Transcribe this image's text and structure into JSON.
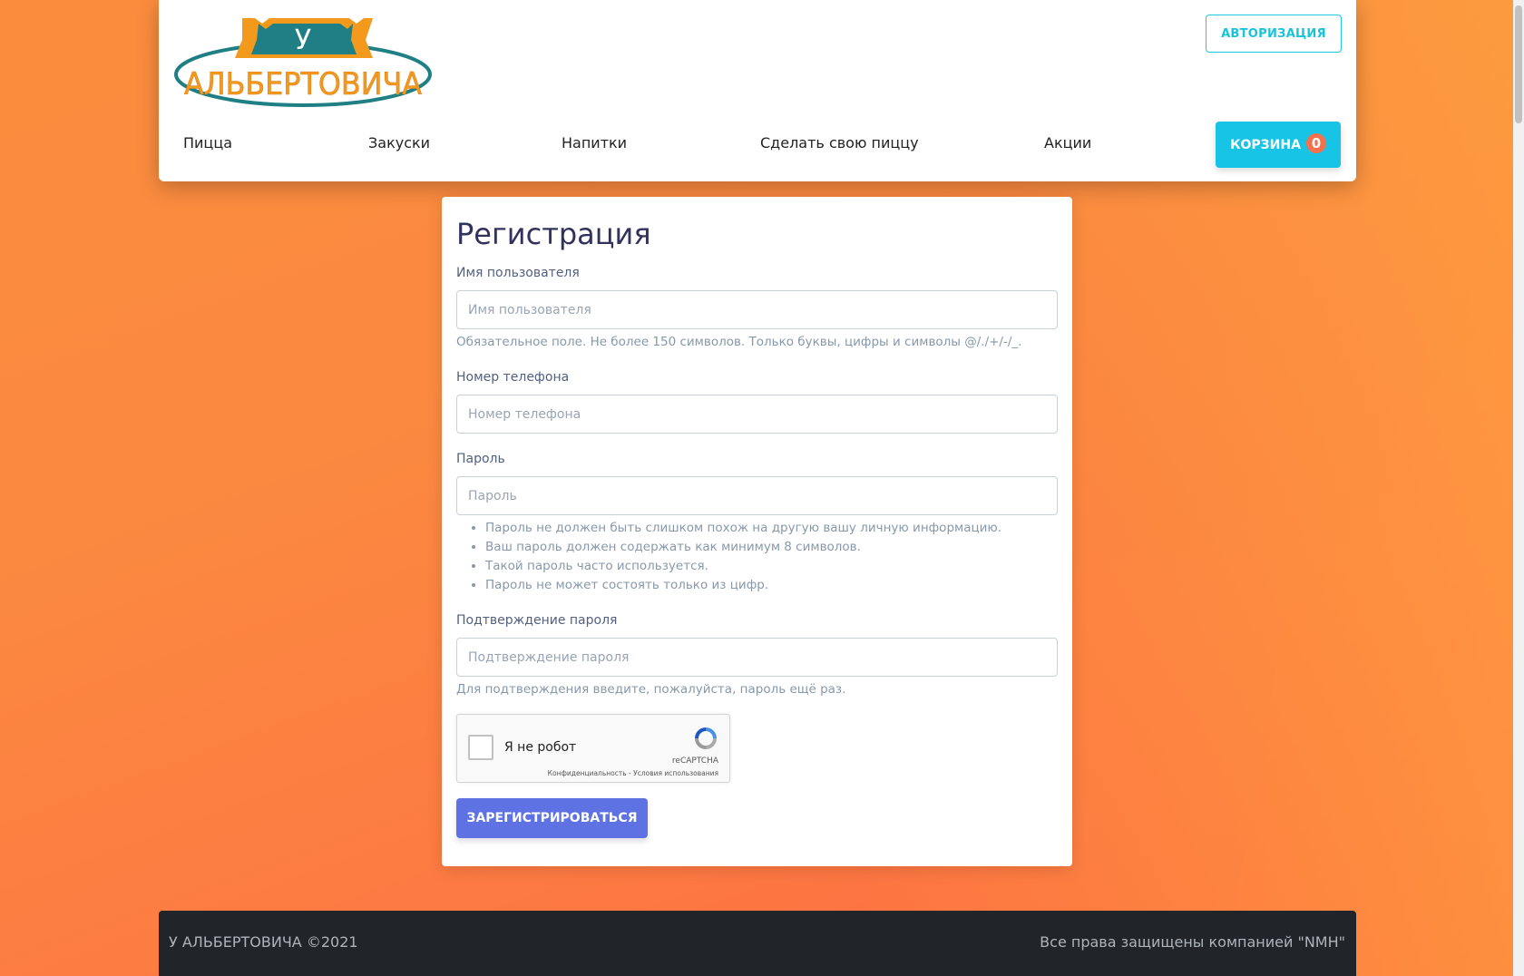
{
  "header": {
    "logo_top": "У",
    "logo_bottom": "АЛЬБЕРТОВИЧА",
    "auth_button": "АВТОРИЗАЦИЯ",
    "nav": [
      "Пицца",
      "Закуски",
      "Напитки",
      "Сделать свою пиццу",
      "Акции"
    ],
    "cart_label": "КОРЗИНА",
    "cart_count": "0"
  },
  "form": {
    "title": "Регистрация",
    "username_label": "Имя пользователя",
    "username_placeholder": "Имя пользователя",
    "username_help": "Обязательное поле. Не более 150 символов. Только буквы, цифры и символы @/./+/-/_.",
    "phone_label": "Номер телефона",
    "phone_placeholder": "Номер телефона",
    "password_label": "Пароль",
    "password_placeholder": "Пароль",
    "password_hints": [
      "Пароль не должен быть слишком похож на другую вашу личную информацию.",
      "Ваш пароль должен содержать как минимум 8 символов.",
      "Такой пароль часто используется.",
      "Пароль не может состоять только из цифр."
    ],
    "confirm_label": "Подтверждение пароля",
    "confirm_placeholder": "Подтверждение пароля",
    "confirm_help": "Для подтверждения введите, пожалуйста, пароль ещё раз.",
    "captcha_label": "Я не робот",
    "captcha_brand": "reCAPTCHA",
    "captcha_links": "Конфиденциальность - Условия использования",
    "submit": "ЗАРЕГИСТРИРОВАТЬСЯ"
  },
  "footer": {
    "left": "У АЛЬБЕРТОВИЧА ©2021",
    "right": "Все права защищены компанией \"NMH\""
  },
  "colors": {
    "accent": "#18c4e6",
    "primary": "#5e72e4",
    "badge": "#f4714b",
    "logo_teal": "#1f7f85",
    "logo_orange": "#f39a1d"
  }
}
